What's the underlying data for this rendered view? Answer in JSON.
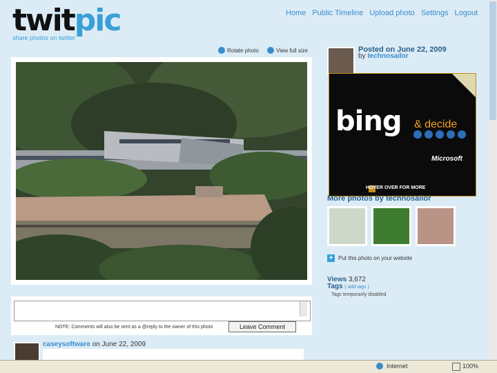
{
  "header": {
    "logo_part1": "twit",
    "logo_part2": "pic",
    "tagline": "share photos on twitter",
    "nav": [
      "Home",
      "Public Timeline",
      "Upload photo",
      "Settings",
      "Logout"
    ]
  },
  "photo_tools": {
    "rotate": "Rotate photo",
    "full_size": "View full size"
  },
  "comment": {
    "note": "NOTE: Comments will also be sent as a @reply to the owner of this photo",
    "leave_button": "Leave Comment"
  },
  "commenter": {
    "name": "caseysoftware",
    "date": "on June 22, 2009"
  },
  "post": {
    "posted": "Posted on June 22, 2009",
    "by": "by",
    "user": "technosailor"
  },
  "ad": {
    "brand": "bing",
    "tagline": "& decide",
    "company": "Microsoft",
    "hover": "HOVER OVER FOR MORE"
  },
  "more_photos_label": "More photos by technosailor",
  "put_photo": "Put this photo on your website",
  "views": {
    "label": "Views",
    "count": "3,672"
  },
  "tags": {
    "label": "Tags",
    "add": "( add tags )",
    "note": "Tags temporarily disabled"
  },
  "status": {
    "zone": "Internet",
    "zoom": "100%"
  },
  "colors": {
    "accent": "#3aa0d8",
    "background": "#dcecf6"
  }
}
